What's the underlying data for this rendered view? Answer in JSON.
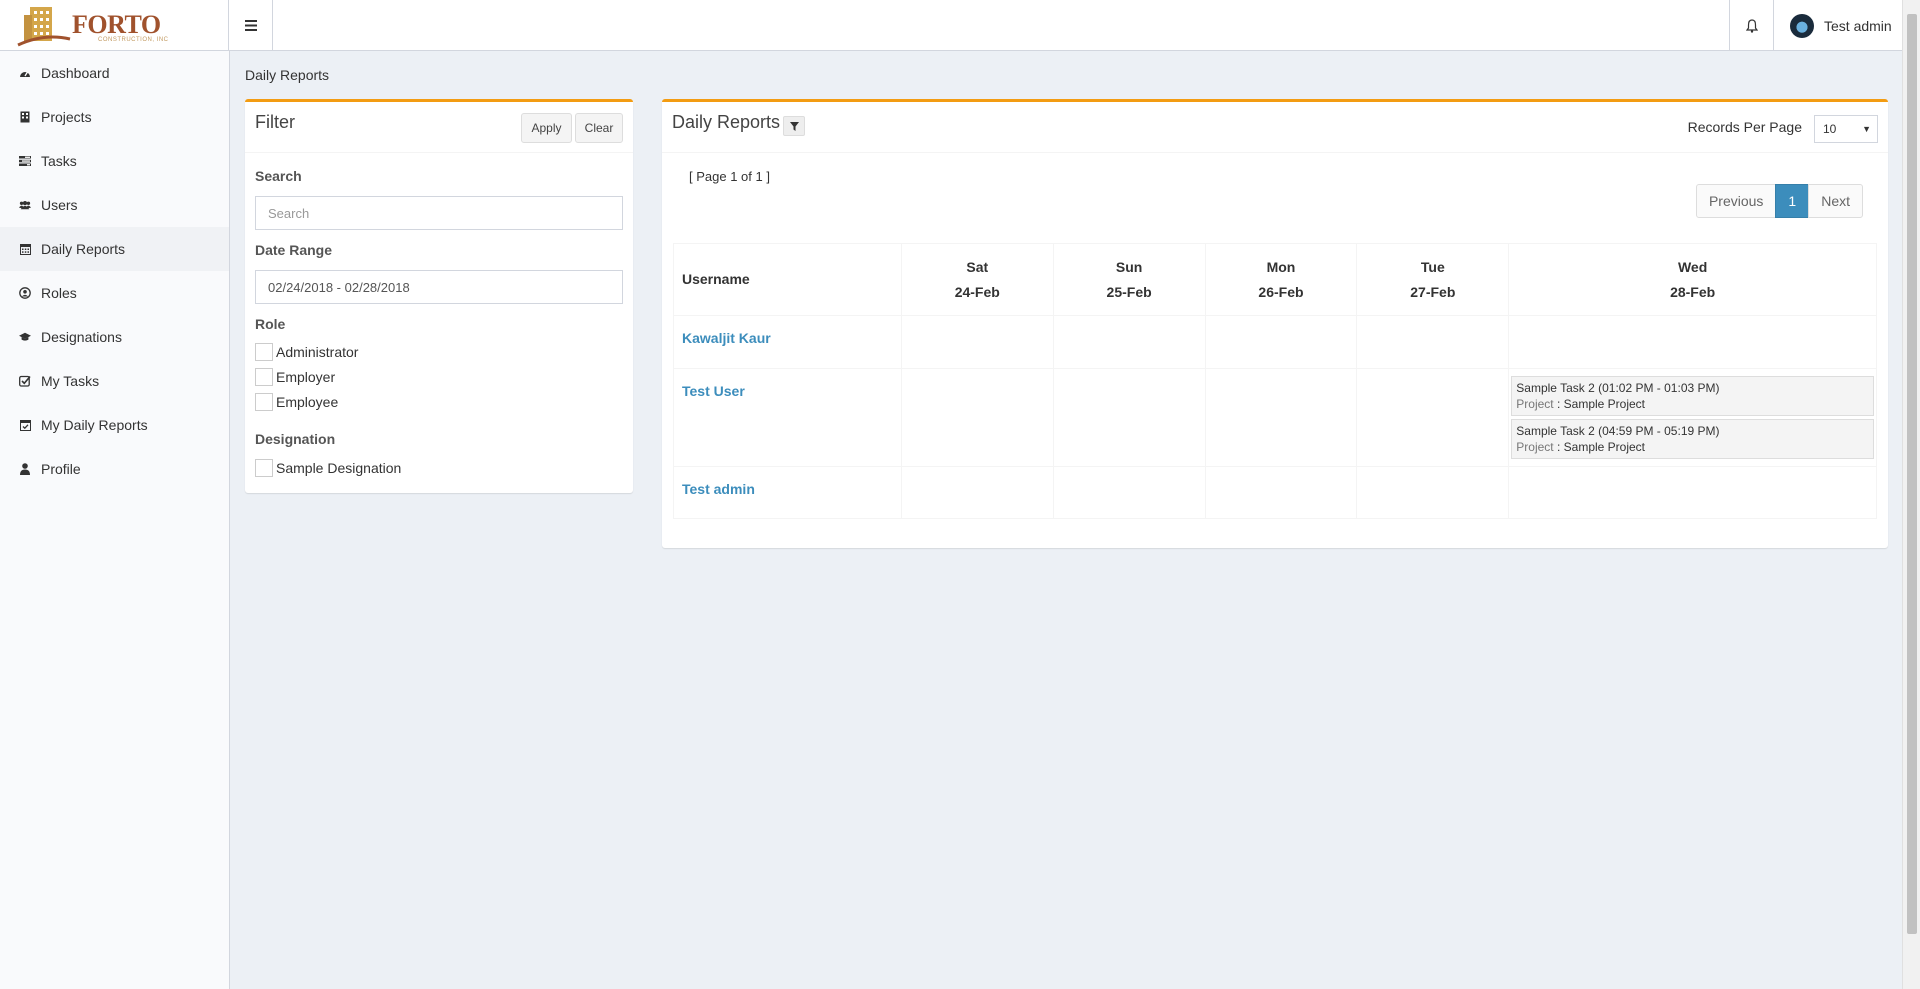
{
  "brand": {
    "name": "FORTO",
    "tagline": "CONSTRUCTION, INC"
  },
  "header": {
    "user_name": "Test admin"
  },
  "sidebar": {
    "items": [
      {
        "label": "Dashboard",
        "icon": "dashboard-icon"
      },
      {
        "label": "Projects",
        "icon": "building-icon"
      },
      {
        "label": "Tasks",
        "icon": "tasks-icon"
      },
      {
        "label": "Users",
        "icon": "users-icon"
      },
      {
        "label": "Daily Reports",
        "icon": "calendar-icon",
        "active": true
      },
      {
        "label": "Roles",
        "icon": "user-circle-icon"
      },
      {
        "label": "Designations",
        "icon": "graduation-cap-icon"
      },
      {
        "label": "My Tasks",
        "icon": "check-square-icon"
      },
      {
        "label": "My Daily Reports",
        "icon": "calendar-check-icon"
      },
      {
        "label": "Profile",
        "icon": "user-icon"
      }
    ]
  },
  "breadcrumb": "Daily Reports",
  "filter": {
    "title": "Filter",
    "apply_label": "Apply",
    "clear_label": "Clear",
    "search_label": "Search",
    "search_placeholder": "Search",
    "date_range_label": "Date Range",
    "date_range_value": "02/24/2018 - 02/28/2018",
    "role_label": "Role",
    "roles": [
      "Administrator",
      "Employer",
      "Employee"
    ],
    "designation_label": "Designation",
    "designations": [
      "Sample Designation"
    ]
  },
  "reports": {
    "title": "Daily Reports",
    "records_per_page_label": "Records Per Page",
    "records_per_page_value": "10",
    "page_info": "[ Page 1 of 1 ]",
    "pager": {
      "previous": "Previous",
      "current": "1",
      "next": "Next"
    },
    "columns": [
      {
        "day": "Username",
        "date": ""
      },
      {
        "day": "Sat",
        "date": "24-Feb"
      },
      {
        "day": "Sun",
        "date": "25-Feb"
      },
      {
        "day": "Mon",
        "date": "26-Feb"
      },
      {
        "day": "Tue",
        "date": "27-Feb"
      },
      {
        "day": "Wed",
        "date": "28-Feb"
      }
    ],
    "rows": [
      {
        "username": "Kawaljit Kaur",
        "tasks": []
      },
      {
        "username": "Test User",
        "tasks": [
          {
            "name": "Sample Task 2",
            "time": "(01:02 PM - 01:03 PM)",
            "project_label": "Project",
            "project": "Sample Project"
          },
          {
            "name": "Sample Task 2",
            "time": "(04:59 PM - 05:19 PM)",
            "project_label": "Project",
            "project": "Sample Project"
          }
        ]
      },
      {
        "username": "Test admin",
        "tasks": []
      }
    ]
  }
}
